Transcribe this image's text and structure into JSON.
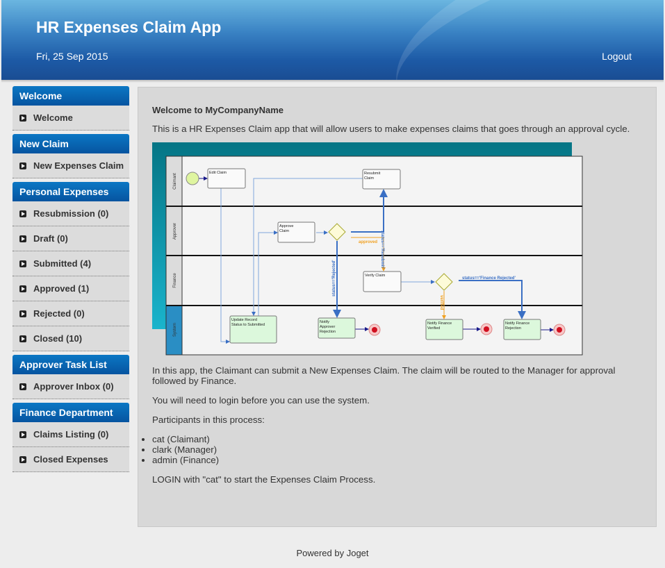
{
  "header": {
    "title": "HR Expenses Claim App",
    "date": "Fri, 25 Sep 2015",
    "logout": "Logout"
  },
  "sidebar": [
    {
      "title": "Welcome",
      "items": [
        "Welcome"
      ]
    },
    {
      "title": "New Claim",
      "items": [
        "New Expenses Claim"
      ]
    },
    {
      "title": "Personal Expenses",
      "items": [
        "Resubmission (0)",
        "Draft (0)",
        "Submitted (4)",
        "Approved (1)",
        "Rejected (0)",
        "Closed (10)"
      ]
    },
    {
      "title": "Approver Task List",
      "items": [
        "Approver Inbox (0)"
      ]
    },
    {
      "title": "Finance Department",
      "items": [
        "Claims Listing (0)",
        "Closed Expenses"
      ]
    }
  ],
  "content": {
    "heading": "Welcome to MyCompanyName",
    "intro": "This is a HR Expenses Claim app that will allow users to make expenses claims that goes through an approval cycle.",
    "p1": "In this app, the Claimant can submit a New Expenses Claim. The claim will be routed to the Manager for approval followed by Finance.",
    "p2": "You will need to login before you can use the system.",
    "p3": "Participants in this process:",
    "participants": [
      "cat (Claimant)",
      "clark (Manager)",
      "admin (Finance)"
    ],
    "p4": "LOGIN with \"cat\" to start the Expenses Claim Process."
  },
  "diagram": {
    "lanes": [
      "Claimant",
      "Approver",
      "Finance",
      "System"
    ],
    "nodes": {
      "edit_claim": "Edit Claim",
      "resubmit_1": "Resubmit",
      "resubmit_2": "Claim",
      "approve_1": "Approve",
      "approve_2": "Claim",
      "verify": "Verify Claim",
      "update_1": "Update Record",
      "update_2": "Status to Submitted",
      "nar_1": "Notify",
      "nar_2": "Approver",
      "nar_3": "Rejection",
      "nfv_1": "Notify Finance",
      "nfv_2": "Verified",
      "nfr_1": "Notify Finance",
      "nfr_2": "Rejection"
    },
    "labels": {
      "resubmit": "status=='Resubmit'",
      "approved": "approved",
      "rejected": "status=='Rejected'",
      "finance_rejected": "status=='Finance Rejected'",
      "verified": "verified"
    }
  },
  "footer": "Powered by Joget"
}
